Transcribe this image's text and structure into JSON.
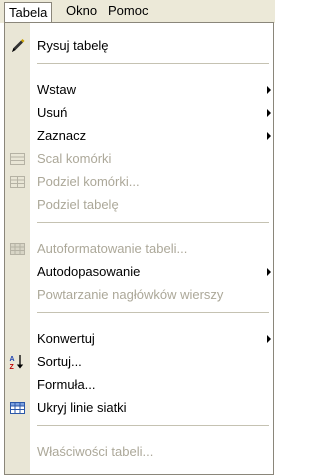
{
  "menubar": {
    "items": [
      {
        "label": "Tabela"
      },
      {
        "label": "Okno"
      },
      {
        "label": "Pomoc"
      }
    ]
  },
  "menu": {
    "items": [
      {
        "label": "Rysuj tabelę",
        "enabled": true,
        "icon": "pencil-icon"
      },
      {
        "label": "Wstaw",
        "enabled": true,
        "submenu": true
      },
      {
        "label": "Usuń",
        "enabled": true,
        "submenu": true
      },
      {
        "label": "Zaznacz",
        "enabled": true,
        "submenu": true
      },
      {
        "label": "Scal komórki",
        "enabled": false,
        "icon": "merge-cells-icon"
      },
      {
        "label": "Podziel komórki...",
        "enabled": false,
        "icon": "split-cells-icon"
      },
      {
        "label": "Podziel tabelę",
        "enabled": false
      },
      {
        "label": "Autoformatowanie tabeli...",
        "enabled": false,
        "icon": "table-autoformat-icon"
      },
      {
        "label": "Autodopasowanie",
        "enabled": true,
        "submenu": true
      },
      {
        "label": "Powtarzanie nagłówków wierszy",
        "enabled": false
      },
      {
        "label": "Konwertuj",
        "enabled": true,
        "submenu": true
      },
      {
        "label": "Sortuj...",
        "enabled": true,
        "icon": "sort-az-icon"
      },
      {
        "label": "Formuła...",
        "enabled": true
      },
      {
        "label": "Ukryj linie siatki",
        "enabled": true,
        "icon": "gridlines-icon"
      },
      {
        "label": "Właściwości tabeli...",
        "enabled": false
      }
    ]
  }
}
